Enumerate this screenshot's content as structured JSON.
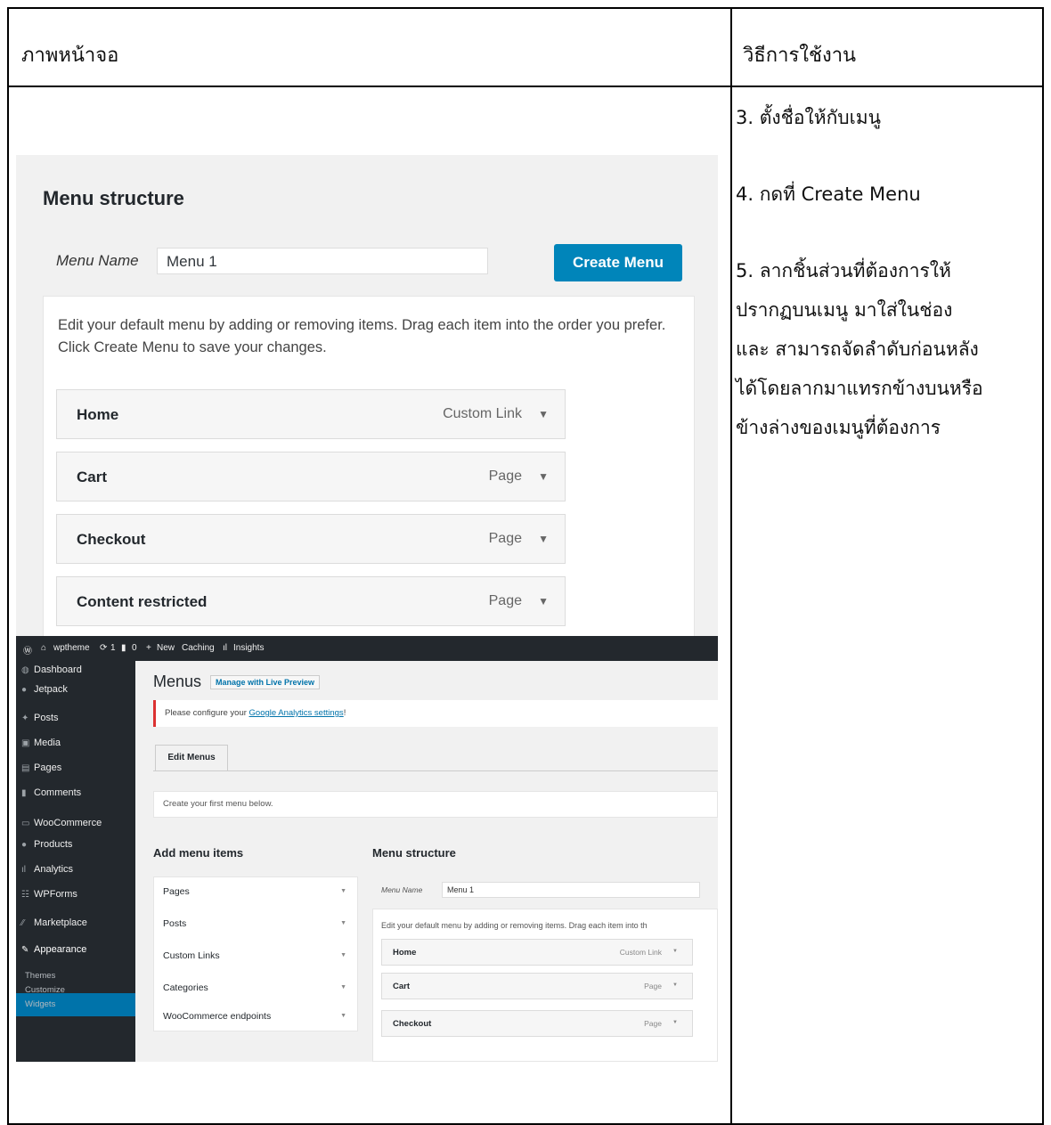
{
  "header": {
    "left": "ภาพหน้าจอ",
    "right": "วิธีการใช้งาน"
  },
  "steps": [
    "3. ตั้งชื่อให้กับเมนู",
    "4. กดที่ Create Menu",
    "5. ลากชิ้นส่วนที่ต้องการให้",
    "ปรากฏบนเมนู มาใส่ในช่อง",
    "และ สามารถจัดลำดับก่อนหลัง",
    "ได้โดยลากมาแทรกข้างบนหรือ",
    "ข้างล่างของเมนูที่ต้องการ"
  ],
  "shot1": {
    "title": "Menu structure",
    "menu_name_label": "Menu Name",
    "menu_name_value": "Menu 1",
    "create_button": "Create Menu",
    "description": "Edit your default menu by adding or removing items. Drag each item into the order you prefer. Click Create Menu to save your changes.",
    "items": [
      {
        "name": "Home",
        "type": "Custom Link"
      },
      {
        "name": "Cart",
        "type": "Page"
      },
      {
        "name": "Checkout",
        "type": "Page"
      },
      {
        "name": "Content restricted",
        "type": "Page"
      }
    ]
  },
  "shot2": {
    "adminbar": {
      "site": "wptheme",
      "updates": "1",
      "comments": "0",
      "new": "New",
      "caching": "Caching",
      "insights": "Insights"
    },
    "sidebar": [
      "Dashboard",
      "Jetpack",
      "Posts",
      "Media",
      "Pages",
      "Comments",
      "WooCommerce",
      "Products",
      "Analytics",
      "WPForms",
      "Marketplace",
      "Appearance"
    ],
    "submenu": [
      "Themes",
      "Customize",
      "Widgets"
    ],
    "page_title": "Menus",
    "live_preview": "Manage with Live Preview",
    "notice_prefix": "Please configure your ",
    "notice_link": "Google Analytics settings",
    "notice_suffix": "!",
    "tab": "Edit Menus",
    "first_menu": "Create your first menu below.",
    "add_items_title": "Add menu items",
    "accordion": [
      "Pages",
      "Posts",
      "Custom Links",
      "Categories",
      "WooCommerce endpoints"
    ],
    "structure_title": "Menu structure",
    "menu_name_label": "Menu Name",
    "menu_name_value": "Menu 1",
    "description": "Edit your default menu by adding or removing items. Drag each item into th",
    "items": [
      {
        "name": "Home",
        "type": "Custom Link"
      },
      {
        "name": "Cart",
        "type": "Page"
      },
      {
        "name": "Checkout",
        "type": "Page"
      }
    ]
  },
  "colors": {
    "primary_button": "#0085ba",
    "admin_dark": "#23282d",
    "active_menu": "#0073aa",
    "notice_error": "#dc3232"
  }
}
